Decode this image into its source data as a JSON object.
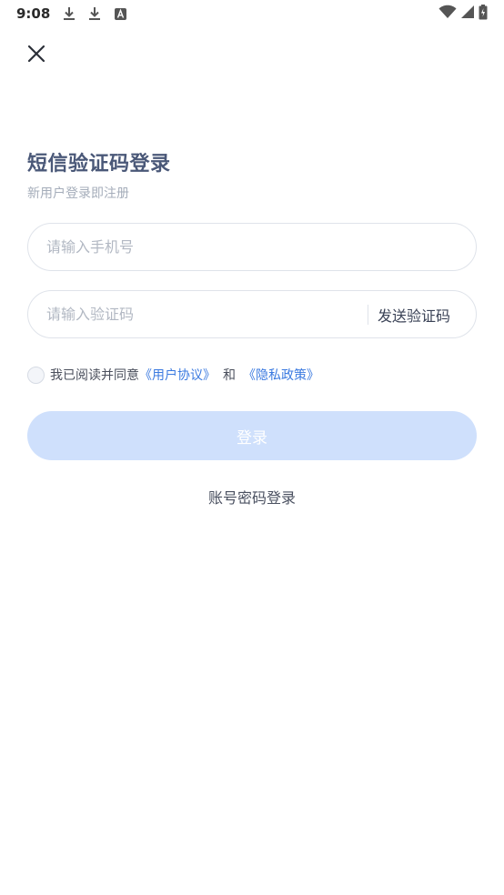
{
  "status_bar": {
    "time": "9:08",
    "left_icons": [
      "download-icon",
      "download-icon",
      "a-notification-icon"
    ],
    "right_icons": [
      "wifi-icon",
      "signal-icon",
      "battery-icon"
    ]
  },
  "header": {
    "close_icon": "close-icon"
  },
  "main": {
    "title": "短信验证码登录",
    "subtitle": "新用户登录即注册",
    "phone_placeholder": "请输入手机号",
    "code_placeholder": "请输入验证码",
    "send_code_label": "发送验证码",
    "agree_text": "我已阅读并同意",
    "user_agreement": "《用户协议》",
    "and_text": "和",
    "privacy_policy": "《隐私政策》",
    "login_label": "登录",
    "alt_login_label": "账号密码登录"
  },
  "colors": {
    "title": "#4a5878",
    "link": "#3b7ae0",
    "login_button_bg": "#cfe0fc",
    "border": "#dfe3ea"
  }
}
